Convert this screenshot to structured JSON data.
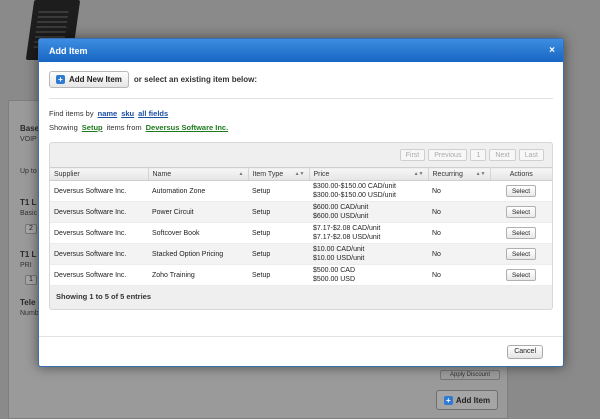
{
  "background": {
    "fragments": [
      "Base",
      "VOIP",
      "Up to",
      "T1 L",
      "Basic",
      "T1 L",
      "PRI",
      "Tele",
      "Numb"
    ],
    "select_values": [
      "2",
      "1"
    ],
    "add_item_label": "Add Item",
    "small_btn_label": "Apply Discount"
  },
  "modal": {
    "title": "Add Item",
    "close_label": "×",
    "add_new_label": "Add New Item",
    "add_hint": "or select an existing item below:",
    "find_prefix": "Find items by",
    "find_links": [
      "name",
      "sku",
      "all fields"
    ],
    "showing_prefix": "Showing",
    "showing_category": "Setup",
    "showing_middle": "items from",
    "showing_supplier": "Deversus Software Inc.",
    "pager": [
      "First",
      "Previous",
      "1",
      "Next",
      "Last"
    ],
    "columns": [
      "Supplier",
      "Name",
      "Item Type",
      "Price",
      "Recurring",
      "Actions"
    ],
    "rows": [
      {
        "supplier": "Deversus Software Inc.",
        "name": "Automation Zone",
        "type": "Setup",
        "price1": "$300.00-$150.00 CAD/unit",
        "price2": "$300.00-$150.00 USD/unit",
        "recurring": "No",
        "action": "Select"
      },
      {
        "supplier": "Deversus Software Inc.",
        "name": "Power Circuit",
        "type": "Setup",
        "price1": "$600.00 CAD/unit",
        "price2": "$600.00 USD/unit",
        "recurring": "No",
        "action": "Select"
      },
      {
        "supplier": "Deversus Software Inc.",
        "name": "Softcover Book",
        "type": "Setup",
        "price1": "$7.17-$2.08 CAD/unit",
        "price2": "$7.17-$2.08 USD/unit",
        "recurring": "No",
        "action": "Select"
      },
      {
        "supplier": "Deversus Software Inc.",
        "name": "Stacked Option Pricing",
        "type": "Setup",
        "price1": "$10.00 CAD/unit",
        "price2": "$10.00 USD/unit",
        "recurring": "No",
        "action": "Select"
      },
      {
        "supplier": "Deversus Software Inc.",
        "name": "Zoho Training",
        "type": "Setup",
        "price1": "$500.00 CAD",
        "price2": "$500.00 USD",
        "recurring": "No",
        "action": "Select"
      }
    ],
    "entries_text": "Showing 1 to 5 of 5 entries",
    "cancel_label": "Cancel"
  },
  "colors": {
    "header_blue": "#1765c2",
    "link_blue": "#1a4fa0",
    "link_green": "#1f7a1f"
  }
}
